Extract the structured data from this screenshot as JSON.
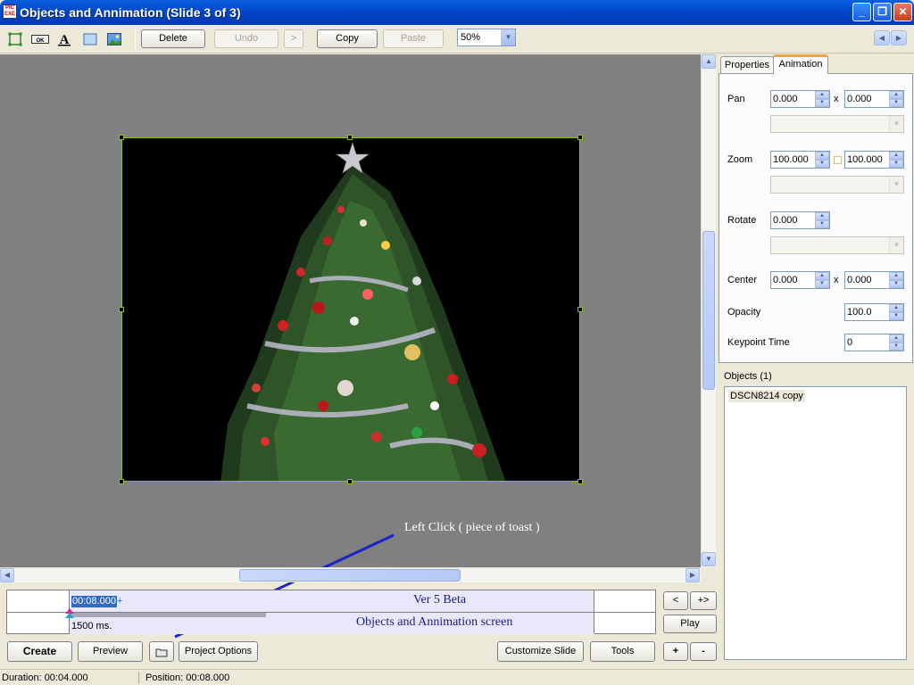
{
  "window": {
    "title": "Objects and Annimation  (Slide 3 of 3)",
    "app_icon": "PIC\nEXE"
  },
  "toolbar": {
    "delete": "Delete",
    "undo": "Undo",
    "redo": ">",
    "copy": "Copy",
    "paste": "Paste",
    "zoom": "50%"
  },
  "annotation": {
    "text": "Left Click ( piece of toast )"
  },
  "tabs": {
    "properties": "Properties",
    "animation": "Animation"
  },
  "animation": {
    "pan_label": "Pan",
    "pan_x": "0.000",
    "pan_sep": "x",
    "pan_y": "0.000",
    "zoom_label": "Zoom",
    "zoom_x": "100.000",
    "zoom_y": "100.000",
    "rotate_label": "Rotate",
    "rotate": "0.000",
    "center_label": "Center",
    "center_x": "0.000",
    "center_sep": "x",
    "center_y": "0.000",
    "opacity_label": "Opacity",
    "opacity": "100.0",
    "keypoint_label": "Keypoint Time",
    "keypoint": "0"
  },
  "objects": {
    "label": "Objects (1)",
    "items": [
      "DSCN8214 copy"
    ]
  },
  "timeline": {
    "time": "00:08.000",
    "plus": "+",
    "duration_label": "1500 ms.",
    "line1": "Ver 5 Beta",
    "line2": "Objects and Annimation screen"
  },
  "nav": {
    "prev": "<",
    "next": "+>",
    "play": "Play",
    "add": "+",
    "remove": "-"
  },
  "bottom": {
    "create": "Create",
    "preview": "Preview",
    "project_options": "Project Options",
    "customize": "Customize Slide",
    "tools": "Tools"
  },
  "status": {
    "duration": "Duration:  00:04.000",
    "position": "Position:  00:08.000"
  }
}
